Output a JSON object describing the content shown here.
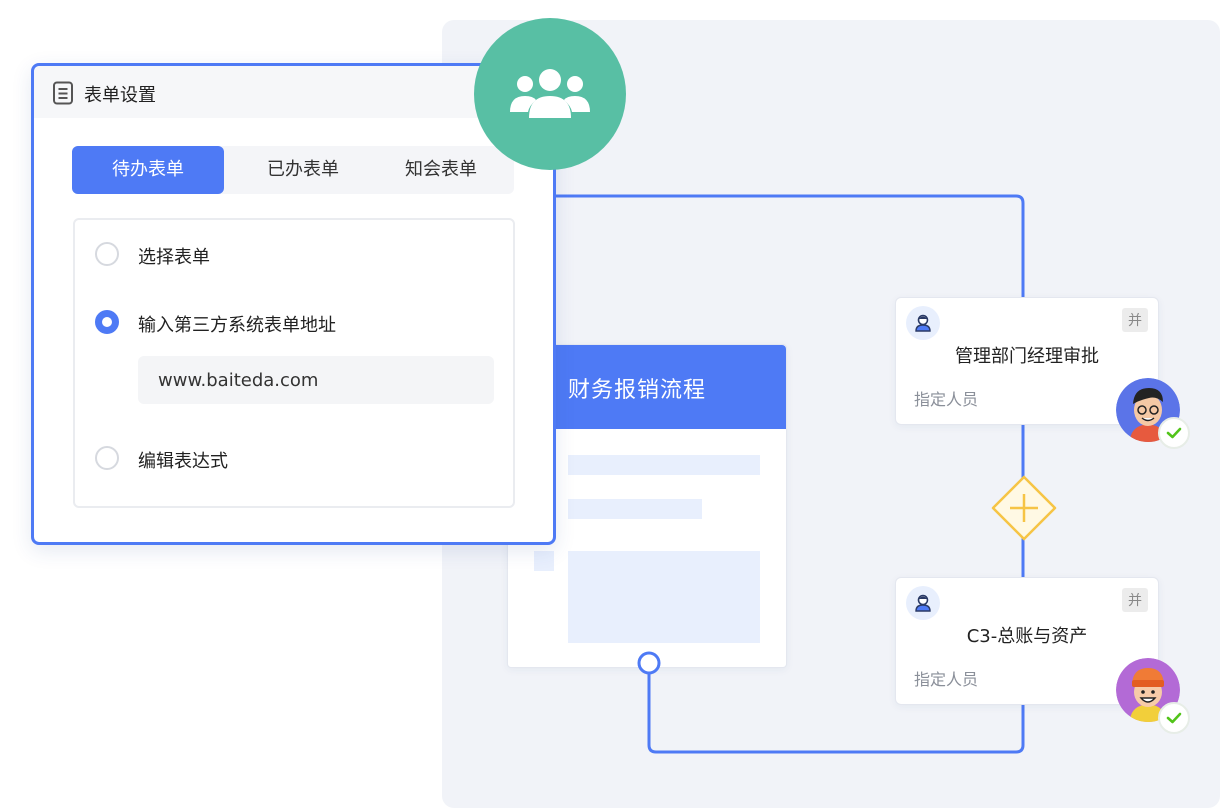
{
  "form_panel": {
    "title": "表单设置",
    "tabs": [
      {
        "label": "待办表单",
        "active": true
      },
      {
        "label": "已办表单",
        "active": false
      },
      {
        "label": "知会表单",
        "active": false
      }
    ],
    "options": [
      {
        "label": "选择表单",
        "selected": false
      },
      {
        "label": "输入第三方系统表单地址",
        "selected": true
      },
      {
        "label": "编辑表达式",
        "selected": false
      }
    ],
    "url_value": "www.baiteda.com"
  },
  "process": {
    "title": "财务报销流程"
  },
  "nodes": [
    {
      "title": "管理部门经理审批",
      "subtitle": "指定人员",
      "badge": "并",
      "approved": true
    },
    {
      "title": "C3-总账与资产",
      "subtitle": "指定人员",
      "badge": "并",
      "approved": true
    }
  ],
  "colors": {
    "accent": "#4e7af5",
    "team": "#58bfa4",
    "gateway": "#f6c445",
    "canvas": "#f1f3f8",
    "check": "#52c41a"
  },
  "icons": {
    "panel": "form-document-icon",
    "team": "users-group-icon",
    "node": "person-icon",
    "gateway": "parallel-gateway-plus-icon",
    "approved": "check-icon"
  }
}
